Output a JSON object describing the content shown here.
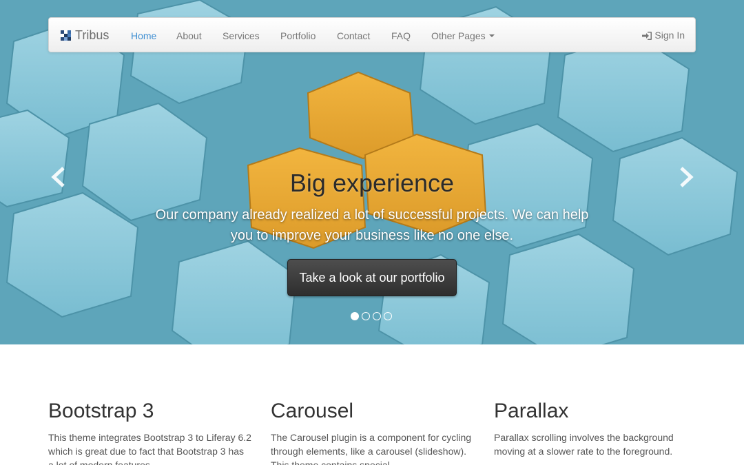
{
  "navbar": {
    "brand": "Tribus",
    "items": [
      {
        "label": "Home",
        "active": true
      },
      {
        "label": "About"
      },
      {
        "label": "Services"
      },
      {
        "label": "Portfolio"
      },
      {
        "label": "Contact"
      },
      {
        "label": "FAQ"
      },
      {
        "label": "Other Pages",
        "dropdown": true
      }
    ],
    "signin_label": "Sign In",
    "signin_icon": "sign-in-icon",
    "active_color": "#3f8fd2"
  },
  "carousel": {
    "title": "Big experience",
    "text": "Our company already realized a lot of successful projects. We can help you to improve your business like no one else.",
    "cta_label": "Take a look at our portfolio",
    "slide_count": 4,
    "active_slide": 1,
    "prev_icon": "chevron-left-icon",
    "next_icon": "chevron-right-icon"
  },
  "features": [
    {
      "title": "Bootstrap 3",
      "text": "This theme integrates Bootstrap 3 to Liferay 6.2 which is great due to fact that Bootstrap 3 has a lot of modern features."
    },
    {
      "title": "Carousel",
      "text": "The Carousel plugin is a component for cycling through elements, like a carousel (slideshow). This theme contains special"
    },
    {
      "title": "Parallax",
      "text": "Parallax scrolling involves the background moving at a slower rate to the foreground."
    }
  ]
}
